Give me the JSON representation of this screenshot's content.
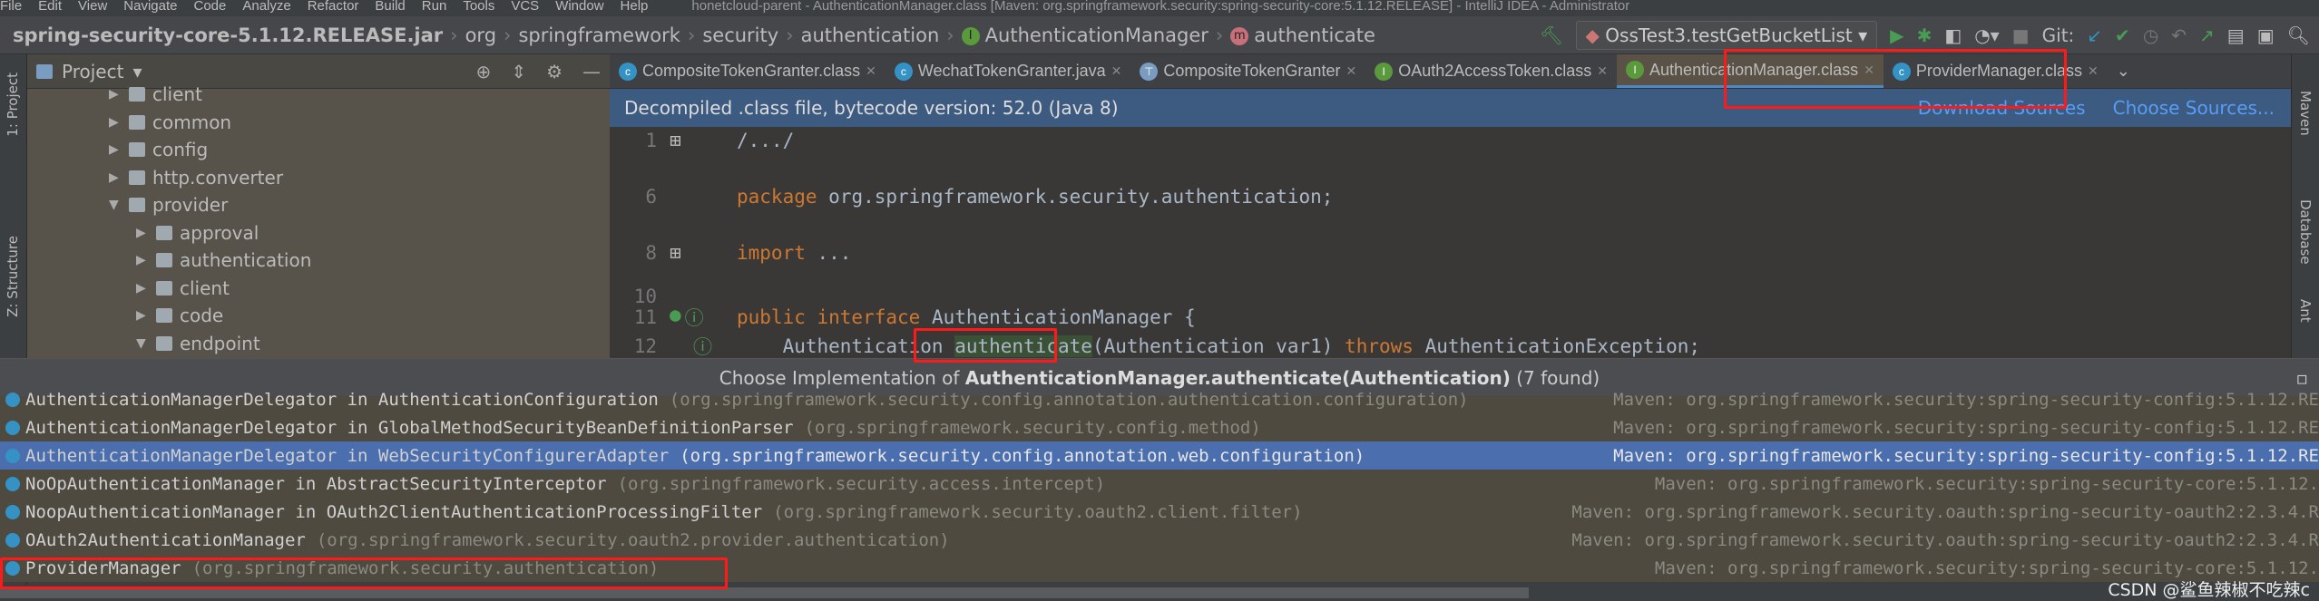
{
  "menu": [
    "File",
    "Edit",
    "View",
    "Navigate",
    "Code",
    "Analyze",
    "Refactor",
    "Build",
    "Run",
    "Tools",
    "VCS",
    "Window",
    "Help"
  ],
  "window_title": "honetcloud-parent - AuthenticationManager.class [Maven: org.springframework.security:spring-security-core:5.1.12.RELEASE] - IntelliJ IDEA - Administrator",
  "breadcrumb": [
    "spring-security-core-5.1.12.RELEASE.jar",
    "org",
    "springframework",
    "security",
    "authentication",
    "AuthenticationManager",
    "authenticate"
  ],
  "toolbar": {
    "run_config": "OssTest3.testGetBucketList",
    "git_label": "Git:"
  },
  "left_strip": {
    "project_tab": "1: Project",
    "structure_tab": "Z: Structure"
  },
  "right_strip": {
    "maven": "Maven",
    "database": "Database",
    "ant": "Ant"
  },
  "project_panel": {
    "title": "Project",
    "tree": [
      {
        "label": "client",
        "expanded": false
      },
      {
        "label": "common",
        "expanded": false
      },
      {
        "label": "config",
        "expanded": false
      },
      {
        "label": "http.converter",
        "expanded": false
      },
      {
        "label": "provider",
        "expanded": true
      },
      {
        "label": "approval",
        "expanded": false
      },
      {
        "label": "authentication",
        "expanded": false
      },
      {
        "label": "client",
        "expanded": false
      },
      {
        "label": "code",
        "expanded": false
      },
      {
        "label": "endpoint",
        "expanded": true
      }
    ]
  },
  "tabs": [
    {
      "label": "CompositeTokenGranter.class",
      "icon": "class-icon"
    },
    {
      "label": "WechatTokenGranter.java",
      "icon": "class-icon"
    },
    {
      "label": "CompositeTokenGranter",
      "icon": "structure-icon"
    },
    {
      "label": "OAuth2AccessToken.class",
      "icon": "interface-icon"
    },
    {
      "label": "AuthenticationManager.class",
      "icon": "interface-icon",
      "active": true
    },
    {
      "label": "ProviderManager.class",
      "icon": "class-icon"
    }
  ],
  "banner": {
    "text": "Decompiled .class file, bytecode version: 52.0 (Java 8)",
    "download": "Download Sources",
    "choose": "Choose Sources..."
  },
  "code": {
    "l1": "1",
    "l1_text": "/.../",
    "l6": "6",
    "l6_kw": "package",
    "l6_text": " org.springframework.security.authentication;",
    "l8": "8",
    "l8_kw": "import",
    "l8_text": " ...",
    "l10": "10",
    "l11": "11",
    "l11_kw": "public interface",
    "l11_text": " AuthenticationManager {",
    "l12": "12",
    "l12_a": "    Authentication ",
    "l12_hl": "authenticate",
    "l12_b": "(Authentication var1) ",
    "l12_kw": "throws",
    "l12_c": " AuthenticationException;"
  },
  "popup": {
    "prefix": "Choose Implementation of ",
    "method": "AuthenticationManager.authenticate(Authentication)",
    "count": " (7 found)"
  },
  "implementations": [
    {
      "name": "AuthenticationManagerDelegator in AuthenticationConfiguration",
      "pkg": "(org.springframework.security.config.annotation.authentication.configuration)",
      "maven": "Maven: org.springframework.security:spring-security-config:5.1.12.RE"
    },
    {
      "name": "AuthenticationManagerDelegator in GlobalMethodSecurityBeanDefinitionParser",
      "pkg": "(org.springframework.security.config.method)",
      "maven": "Maven: org.springframework.security:spring-security-config:5.1.12.RE"
    },
    {
      "name": "AuthenticationManagerDelegator in WebSecurityConfigurerAdapter",
      "pkg": "(org.springframework.security.config.annotation.web.configuration)",
      "maven": "Maven: org.springframework.security:spring-security-config:5.1.12.RE",
      "selected": true
    },
    {
      "name": "NoOpAuthenticationManager in AbstractSecurityInterceptor",
      "pkg": "(org.springframework.security.access.intercept)",
      "maven": "Maven: org.springframework.security:spring-security-core:5.1.12."
    },
    {
      "name": "NoopAuthenticationManager in OAuth2ClientAuthenticationProcessingFilter",
      "pkg": "(org.springframework.security.oauth2.client.filter)",
      "maven": "Maven: org.springframework.security.oauth:spring-security-oauth2:2.3.4.R"
    },
    {
      "name": "OAuth2AuthenticationManager",
      "pkg": "(org.springframework.security.oauth2.provider.authentication)",
      "maven": "Maven: org.springframework.security.oauth:spring-security-oauth2:2.3.4.R"
    },
    {
      "name": "ProviderManager",
      "pkg": "(org.springframework.security.authentication)",
      "maven": "Maven: org.springframework.security:spring-security-core:5.1.12."
    }
  ],
  "watermark": "CSDN @鲨鱼辣椒不吃辣c",
  "colors": {
    "selection": "#4b6eaf",
    "keyword": "#cc7832",
    "annotation_box": "#ff1a1a",
    "banner": "#3d5a80"
  }
}
